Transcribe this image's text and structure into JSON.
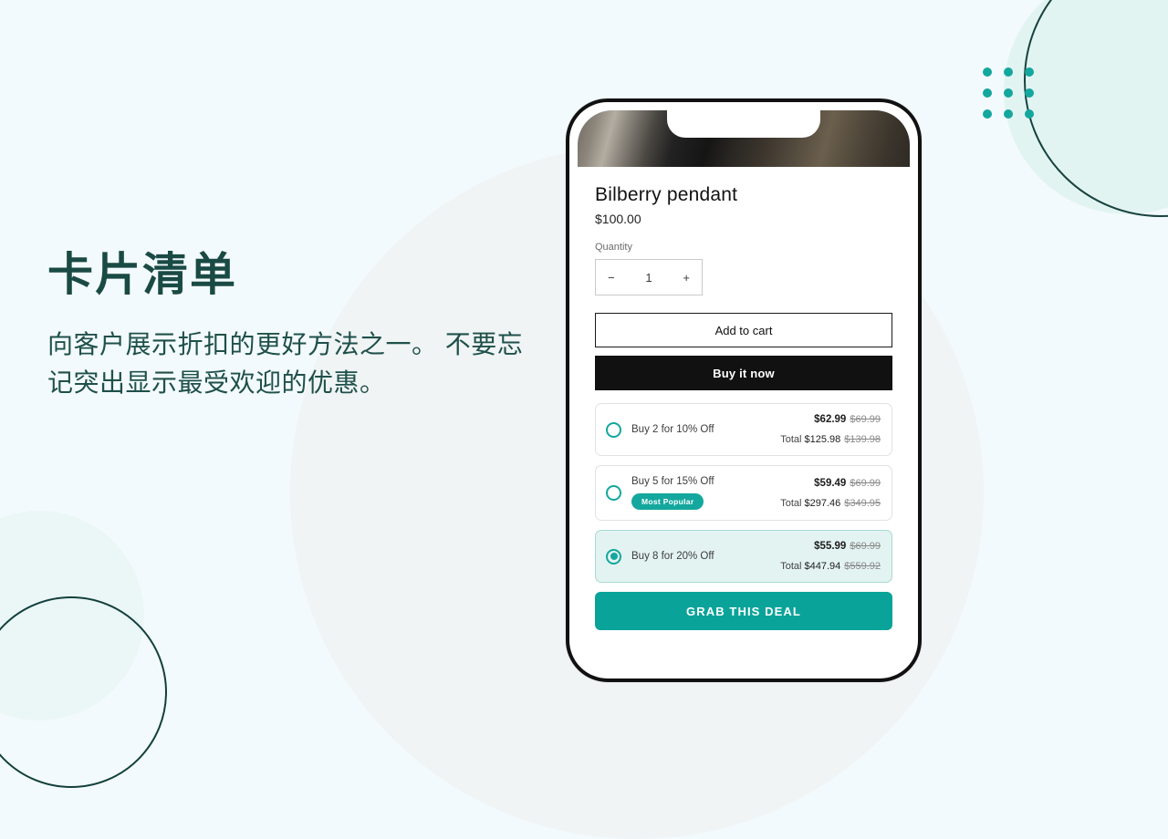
{
  "slide": {
    "headline": "卡片清单",
    "subcopy": "向客户展示折扣的更好方法之一。 不要忘记突出显示最受欢迎的优惠。"
  },
  "colors": {
    "background": "#f3fafd",
    "heading_green": "#1a4a44",
    "teal_accent": "#14a79e",
    "cta_teal": "#0aa399",
    "selected_card_bg": "#e3f3f1",
    "buy_now_black": "#111111"
  },
  "phone": {
    "product": {
      "title": "Bilberry pendant",
      "price": "$100.00"
    },
    "quantity": {
      "label": "Quantity",
      "value": "1",
      "decrement": "−",
      "increment": "+"
    },
    "actions": {
      "add_to_cart": "Add to cart",
      "buy_it_now": "Buy it now",
      "grab_deal": "GRAB THIS DEAL"
    },
    "offers": [
      {
        "name": "Buy 2 for 10% Off",
        "unit_price": "$62.99",
        "unit_compare": "$69.99",
        "total_label": "Total",
        "total_price": "$125.98",
        "total_compare": "$139.98",
        "badge": "",
        "selected": false
      },
      {
        "name": "Buy 5 for 15% Off",
        "unit_price": "$59.49",
        "unit_compare": "$69.99",
        "total_label": "Total",
        "total_price": "$297.46",
        "total_compare": "$349.95",
        "badge": "Most Popular",
        "selected": false
      },
      {
        "name": "Buy 8 for 20% Off",
        "unit_price": "$55.99",
        "unit_compare": "$69.99",
        "total_label": "Total",
        "total_price": "$447.94",
        "total_compare": "$559.92",
        "badge": "",
        "selected": true
      }
    ]
  }
}
